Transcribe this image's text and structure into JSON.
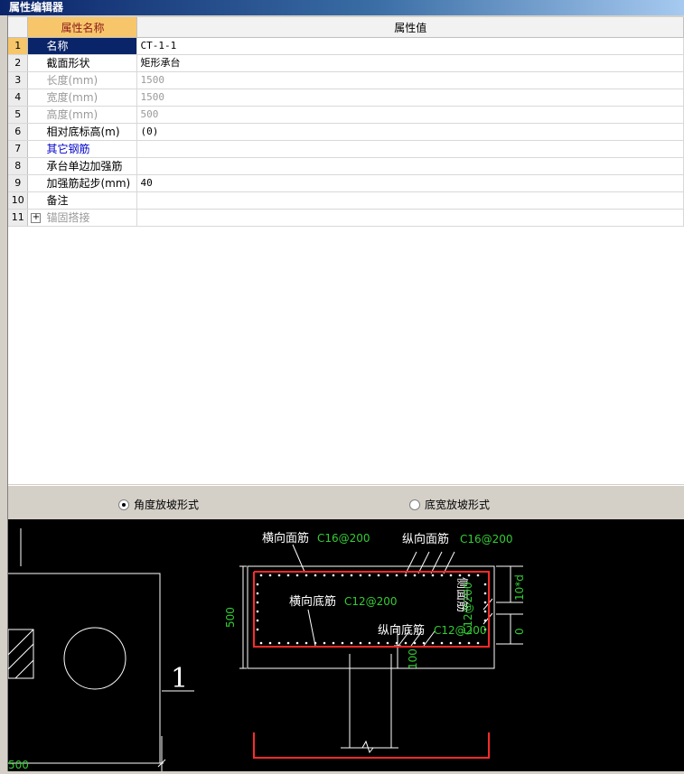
{
  "window": {
    "title": "属性编辑器"
  },
  "grid": {
    "header_name": "属性名称",
    "header_value": "属性值",
    "rows": [
      {
        "no": "1",
        "name": "名称",
        "value": "CT-1-1"
      },
      {
        "no": "2",
        "name": "截面形状",
        "value": "矩形承台"
      },
      {
        "no": "3",
        "name": "长度(mm)",
        "value": "1500"
      },
      {
        "no": "4",
        "name": "宽度(mm)",
        "value": "1500"
      },
      {
        "no": "5",
        "name": "高度(mm)",
        "value": "500"
      },
      {
        "no": "6",
        "name": "相对底标高(m)",
        "value": "(0)"
      },
      {
        "no": "7",
        "name": "其它钢筋",
        "value": ""
      },
      {
        "no": "8",
        "name": "承台单边加强筋",
        "value": ""
      },
      {
        "no": "9",
        "name": "加强筋起步(mm)",
        "value": "40"
      },
      {
        "no": "10",
        "name": "备注",
        "value": ""
      },
      {
        "no": "11",
        "name": "锚固搭接",
        "value": "",
        "expander": "+"
      }
    ]
  },
  "slope_options": {
    "angle": "角度放坡形式",
    "width": "底宽放坡形式",
    "selected": "angle"
  },
  "drawing": {
    "colors": {
      "rebar": "#ff2a2a",
      "label": "#33cc33",
      "line": "#ffffff"
    },
    "labels": {
      "top_transverse": "横向面筋",
      "top_transverse_spec": "C16@200",
      "top_longitudinal": "纵向面筋",
      "top_longitudinal_spec": "C16@200",
      "bottom_transverse": "横向底筋",
      "bottom_transverse_spec": "C12@200",
      "bottom_longitudinal": "纵向底筋",
      "bottom_longitudinal_spec": "C12@200",
      "side": "侧面筋",
      "side_spec": "C12@200",
      "height_dim": "500",
      "cover_dim": "100",
      "anchor_dim": "10*d",
      "zero_dim": "0",
      "section_mark": "1",
      "plan_dim": "500"
    }
  }
}
